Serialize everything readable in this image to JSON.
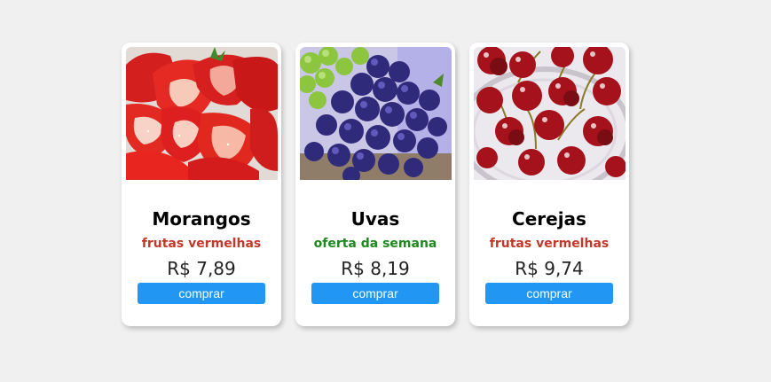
{
  "products": [
    {
      "name": "Morangos",
      "tag": "frutas vermelhas",
      "tag_color": "#c0392b",
      "price": "R$ 7,89",
      "button_label": "comprar",
      "image": "strawberries-image"
    },
    {
      "name": "Uvas",
      "tag": "oferta da semana",
      "tag_color": "#1e8a1e",
      "price": "R$ 8,19",
      "button_label": "comprar",
      "image": "grapes-image"
    },
    {
      "name": "Cerejas",
      "tag": "frutas vermelhas",
      "tag_color": "#c0392b",
      "price": "R$ 9,74",
      "button_label": "comprar",
      "image": "cherries-image"
    }
  ],
  "colors": {
    "button": "#2196f3",
    "background": "#f0f0f0",
    "card": "#ffffff"
  }
}
